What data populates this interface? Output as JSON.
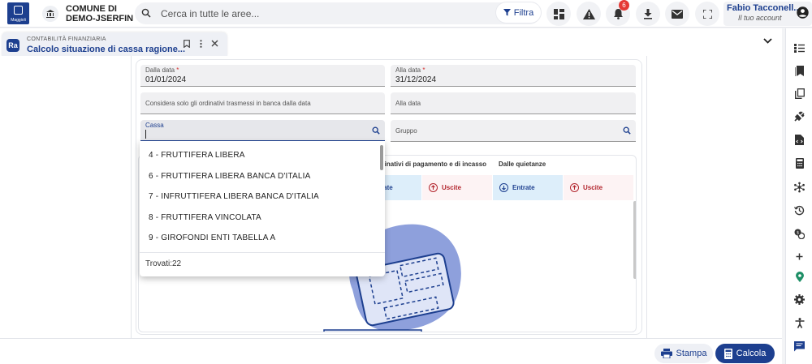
{
  "header": {
    "logo_text": "Maggioli",
    "municipality": [
      "COMUNE DI",
      "DEMO-JSERFIN"
    ],
    "search_placeholder": "Cerca in tutte le aree...",
    "filter_label": "Filtra",
    "notifications_count": "6",
    "user_name": "Fabio Tacconell...",
    "user_role": "Il tuo account"
  },
  "tab": {
    "app_icon": "Ra",
    "category": "CONTABILITÀ FINANZIARIA",
    "title": "Calcolo situazione di cassa ragione..."
  },
  "form": {
    "dalla_data": {
      "label": "Dalla data",
      "value": "01/01/2024"
    },
    "alla_data": {
      "label": "Alla data",
      "value": "31/12/2024"
    },
    "considera": {
      "placeholder": "Considera solo gli ordinativi trasmessi in banca dalla data"
    },
    "alla_data2": {
      "placeholder": "Alla data"
    },
    "cassa": {
      "label": "Cassa",
      "value": ""
    },
    "gruppo": {
      "placeholder": "Gruppo"
    }
  },
  "grid": {
    "header_ordinativi": "...inativi di pagamento e di incasso",
    "header_quietanze": "Dalle quietanze",
    "entrate": "Entrate",
    "uscite": "Uscite",
    "entrate_partial": "rate"
  },
  "dropdown": {
    "options": [
      "4 - FRUTTIFERA LIBERA",
      "6 - FRUTTIFERA LIBERA BANCA D'ITALIA",
      "7 - INFRUTTIFERA LIBERA BANCA D'ITALIA",
      "8 - FRUTTIFERA VINCOLATA",
      "9 - GIROFONDI ENTI TABELLA A"
    ],
    "found": "Trovati:22"
  },
  "actions": {
    "stampa": "Stampa",
    "calcola": "Calcola"
  },
  "colors": {
    "primary": "#1d3f8f",
    "danger": "#b3262e",
    "badge": "#e53935"
  },
  "right_sidebar_icons": [
    "list-icon",
    "bookmarks-icon",
    "copy-icon",
    "plug-icon",
    "document-code-icon",
    "calculator-icon",
    "hub-icon",
    "history-icon",
    "exchange-icon",
    "add-icon",
    "location-icon",
    "settings-icon",
    "accessibility-icon",
    "chat-icon"
  ]
}
